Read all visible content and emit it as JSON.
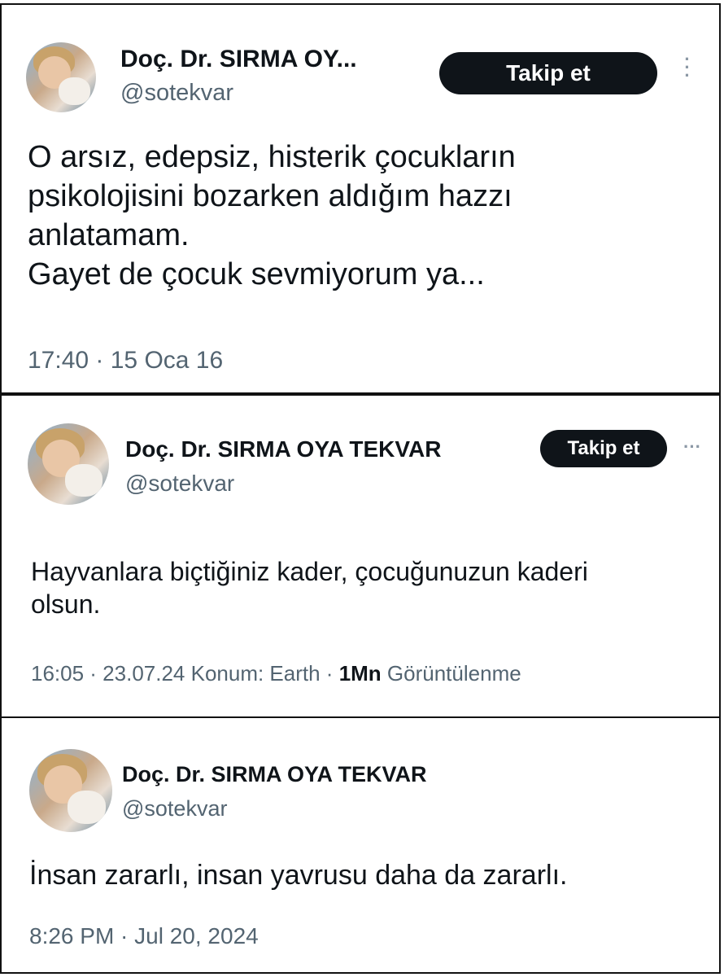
{
  "tweets": [
    {
      "name": "Doç. Dr. SIRMA OY...",
      "handle": "@sotekvar",
      "follow_label": "Takip et",
      "lines": [
        "O arsız, edepsiz, histerik çocukların",
        "psikolojisini bozarken aldığım hazzı",
        "anlatamam.",
        "Gayet de çocuk sevmiyorum ya..."
      ],
      "meta": "17:40 · 15 Oca 16"
    },
    {
      "name": "Doç. Dr. SIRMA OYA TEKVAR",
      "handle": "@sotekvar",
      "follow_label": "Takip et",
      "lines": [
        "Hayvanlara biçtiğiniz kader, çocuğunuzun kaderi",
        "olsun."
      ],
      "meta_prefix": "16:05 · 23.07.24 Konum: Earth ·",
      "meta_views_count": "1Mn",
      "meta_views_label": "Görüntülenme"
    },
    {
      "name": "Doç. Dr. SIRMA OYA TEKVAR",
      "handle": "@sotekvar",
      "lines": [
        "İnsan zararlı, insan yavrusu daha da zararlı."
      ],
      "meta": "8:26 PM · Jul 20, 2024"
    }
  ]
}
